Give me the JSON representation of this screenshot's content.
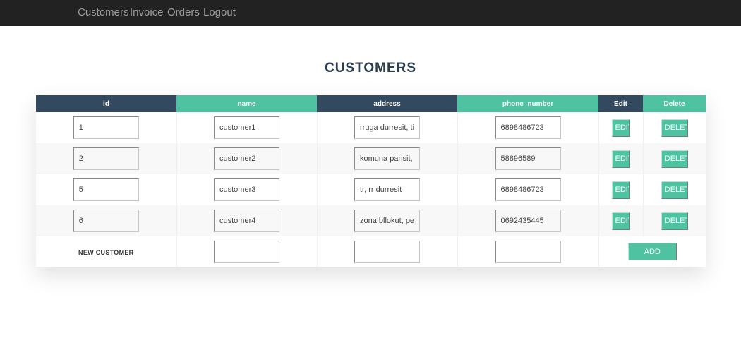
{
  "nav": {
    "links": [
      "Customers",
      "Invoice",
      "Orders",
      "Logout"
    ],
    "background": "#222222"
  },
  "page": {
    "title": "CUSTOMERS"
  },
  "table": {
    "columns": [
      "id",
      "name",
      "address",
      "phone_number",
      "Edit",
      "Delete"
    ],
    "rows": [
      {
        "id": "1",
        "name": "customer1",
        "address": "rruga durresit, tirana",
        "phone": "6898486723"
      },
      {
        "id": "2",
        "name": "customer2",
        "address": "komuna parisit, prane",
        "phone": "58896589"
      },
      {
        "id": "5",
        "name": "customer3",
        "address": "tr, rr durresit",
        "phone": "6898486723"
      },
      {
        "id": "6",
        "name": "customer4",
        "address": "zona bllokut, perballe",
        "phone": "0692435445"
      }
    ],
    "edit_label": "EDIT",
    "delete_label": "DELETE",
    "new_row": {
      "label": "NEW CUSTOMER",
      "add_label": "ADD",
      "name": "",
      "address": "",
      "phone": ""
    }
  },
  "colors": {
    "header_dark": "#324960",
    "header_green": "#4fc3a1",
    "button": "#4fc3a1",
    "title": "#2c3e50"
  }
}
